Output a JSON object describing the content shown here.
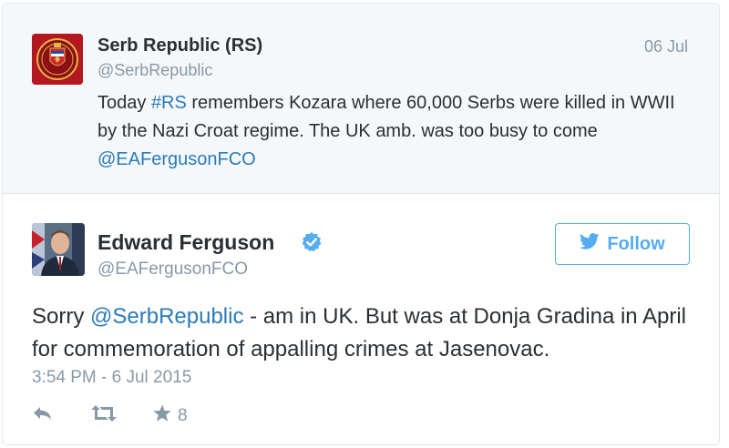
{
  "parent_tweet": {
    "name": "Serb Republic (RS)",
    "handle": "@SerbRepublic",
    "date": "06 Jul",
    "text_before": "Today ",
    "hashtag": "#RS",
    "text_middle": " remembers Kozara where 60,000 Serbs were killed in WWII by the Nazi Croat regime. The UK amb. was too busy to come ",
    "mention": "@EAFergusonFCO"
  },
  "main_tweet": {
    "name": "Edward Ferguson",
    "handle": "@EAFergusonFCO",
    "follow_label": "Follow",
    "text_before": "Sorry ",
    "mention": "@SerbRepublic",
    "text_after": " - am in UK. But was at Donja Gradina in April for commemoration of appalling crimes at Jasenovac.",
    "timestamp": "3:54 PM - 6 Jul 2015",
    "favorite_count": "8"
  },
  "icons": {
    "avatar_parent": "coat-of-arms",
    "avatar_main": "profile-photo",
    "verified": "verified-badge-icon",
    "follow": "twitter-bird-icon",
    "reply": "reply-icon",
    "retweet": "retweet-icon",
    "favorite": "star-icon"
  },
  "colors": {
    "link": "#2b7bb9",
    "accent": "#55acee",
    "muted": "#8899a6",
    "parent_bg": "#f5f8fa"
  }
}
